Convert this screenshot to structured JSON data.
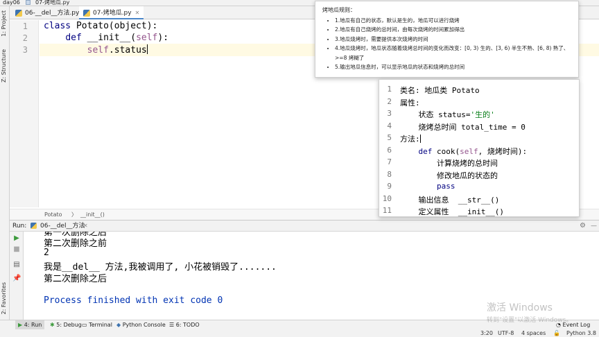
{
  "window": {
    "project": "day06",
    "file": "07-烤地瓜.py"
  },
  "tabs": [
    {
      "label": "06-__del__方法.py",
      "active": false
    },
    {
      "label": "07-烤地瓜.py",
      "active": true
    }
  ],
  "side_labels": {
    "project": "1: Project",
    "structure": "Z: Structure",
    "favorites": "2: Favorites"
  },
  "editor": {
    "line_numbers": [
      "1",
      "2",
      "3"
    ],
    "lines": {
      "l1_kw": "class",
      "l1_rest": " Potato(object):",
      "l2_kw": "def",
      "l2_rest": " __init__(",
      "l2_self": "self",
      "l2_end": "):",
      "l3_self": "self",
      "l3_rest": ".status"
    },
    "breadcrumb": [
      "Potato",
      "__init__()"
    ]
  },
  "run": {
    "label": "Run:",
    "config": "06-__del__方法",
    "output": [
      "第二次删除之前",
      "2",
      "我是__del__ 方法,我被调用了, 小花被销毁了.......",
      "第二次删除之后",
      "",
      "Process finished with exit code 0"
    ],
    "cut_line": "第一次删除之后"
  },
  "toolbar": {
    "run": "4: Run",
    "debug": "5: Debug",
    "terminal": "Terminal",
    "python_console": "Python Console",
    "todo": "6: TODO",
    "event_log": "Event Log"
  },
  "status": {
    "position": "3:20",
    "encoding": "UTF-8",
    "indent": "4 spaces",
    "interpreter": "Python 3.8"
  },
  "rules_popup": {
    "title": "烤地瓜规则：",
    "items": [
      "1.地瓜有自己的状态，默认是生的，地瓜可以进行烧烤",
      "2.地瓜有自己烧烤的总时间，由每次烧烤的时间累加得出",
      "3.地瓜烧烤时，需要提供本次烧烤的时间",
      "4.地瓜烧烤时，地瓜状态随着烧烤总时间的变化而改变：[0, 3) 生的、[3, 6) 半生不熟、[6, 8) 熟了、>=8 烤糊了",
      "5.输出地瓜信息时，可以显示地瓜的状态和烧烤的总时间"
    ]
  },
  "notes": {
    "line_numbers": [
      "1",
      "2",
      "3",
      "4",
      "5",
      "6",
      "7",
      "8",
      "9",
      "10",
      "11"
    ],
    "l1": "类名: 地瓜类 Potato",
    "l2": "属性:",
    "l3_a": "    状态 status=",
    "l3_str": "'生的'",
    "l4": "    烧烤总时间 total_time = 0",
    "l5": "方法:",
    "l6_kw": "    def",
    "l6_a": " cook(",
    "l6_self": "self",
    "l6_b": ", 烧烤时间):",
    "l7": "        计算烧烤的总时间",
    "l8": "        修改地瓜的状态的",
    "l9": "pass",
    "l10": "    输出信息  __str__()",
    "l11": "    定义属性  __init__()"
  },
  "watermark": {
    "line1": "激活 Windows",
    "line2": "转到\"设置\"以激活 Windows。"
  }
}
